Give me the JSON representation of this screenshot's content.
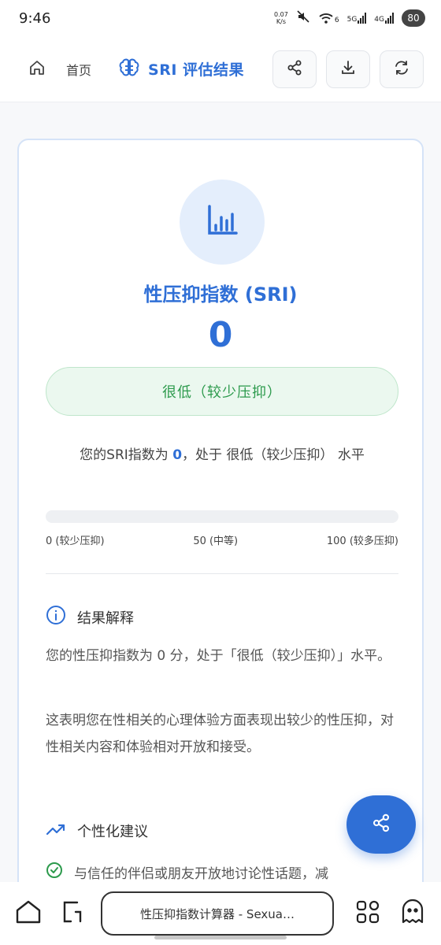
{
  "status_bar": {
    "time": "9:46",
    "net_speed_value": "0.07",
    "net_speed_unit": "K/s",
    "signal_5g": "5G",
    "signal_4g": "4G",
    "wifi_label": "6",
    "battery": "80"
  },
  "header": {
    "home_label": "首页",
    "title": "SRI 评估结果",
    "icons": [
      "home-icon",
      "brain-icon",
      "share-icon",
      "download-icon",
      "refresh-icon"
    ]
  },
  "result": {
    "title": "性压抑指数 (SRI)",
    "score": "0",
    "level": "很低（较少压抑）",
    "summary_prefix": "您的SRI指数为",
    "summary_score": "0",
    "summary_suffix": "，处于 很低（较少压抑） 水平",
    "progress_percent": 0,
    "scale_low": "0 (较少压抑)",
    "scale_mid": "50 (中等)",
    "scale_high": "100 (较多压抑)"
  },
  "interpretation": {
    "heading": "结果解释",
    "paragraph1": "您的性压抑指数为 0 分，处于「很低（较少压抑）」水平。",
    "paragraph2": "这表明您在性相关的心理体验方面表现出较少的性压抑，对性相关内容和体验相对开放和接受。"
  },
  "advice": {
    "heading": "个性化建议",
    "tip1": "与信任的伴侣或朋友开放地讨论性话题，减"
  },
  "browser": {
    "url_title": "性压抑指数计算器 - Sexua…"
  },
  "colors": {
    "accent": "#2f6fd6",
    "success": "#2c9a4c",
    "success_bg": "#ebf8ef"
  }
}
